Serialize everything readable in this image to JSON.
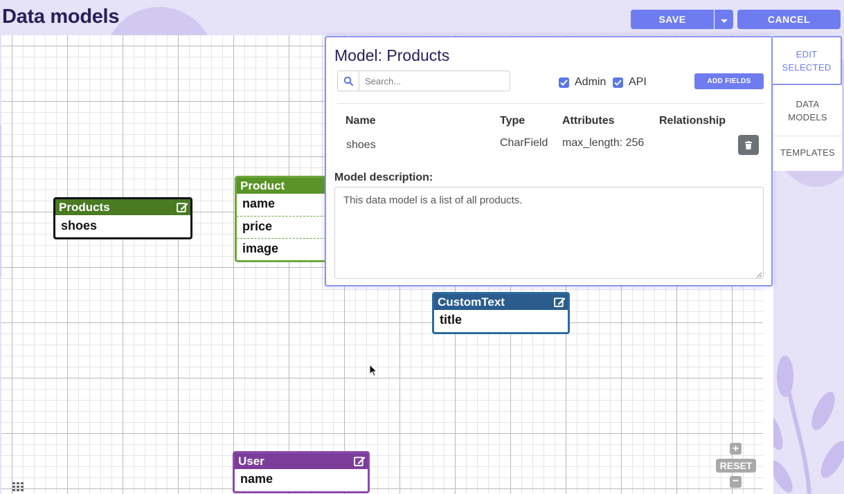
{
  "page": {
    "title": "Data models"
  },
  "toolbar": {
    "save_label": "SAVE",
    "cancel_label": "CANCEL"
  },
  "nodes": {
    "products": {
      "title": "Products",
      "fields": [
        "shoes"
      ],
      "color": "#4a7a22"
    },
    "product": {
      "title": "Product",
      "fields": [
        "name",
        "price",
        "image"
      ],
      "color": "#5a9428"
    },
    "custom_text": {
      "title": "CustomText",
      "fields": [
        "title"
      ],
      "color": "#2a5d8e"
    },
    "user": {
      "title": "User",
      "fields": [
        "name"
      ],
      "color": "#7c3d9a"
    }
  },
  "zoom": {
    "reset_label": "RESET"
  },
  "panel": {
    "title": "Model: Products",
    "search_placeholder": "Search...",
    "admin_label": "Admin",
    "api_label": "API",
    "admin_checked": true,
    "api_checked": true,
    "add_fields_label": "ADD FIELDS",
    "columns": {
      "name": "Name",
      "type": "Type",
      "attributes": "Attributes",
      "relationship": "Relationship"
    },
    "rows": [
      {
        "name": "shoes",
        "type": "CharField",
        "attributes": "max_length: 256",
        "relationship": ""
      }
    ],
    "description_label": "Model description:",
    "description_value": "This data model is a list of all products."
  },
  "side_tabs": {
    "edit_selected_line1": "EDIT",
    "edit_selected_line2": "SELECTED",
    "data_models_line1": "DATA",
    "data_models_line2": "MODELS",
    "templates": "TEMPLATES"
  },
  "colors": {
    "accent": "#6f7cf0",
    "title": "#27205a"
  }
}
